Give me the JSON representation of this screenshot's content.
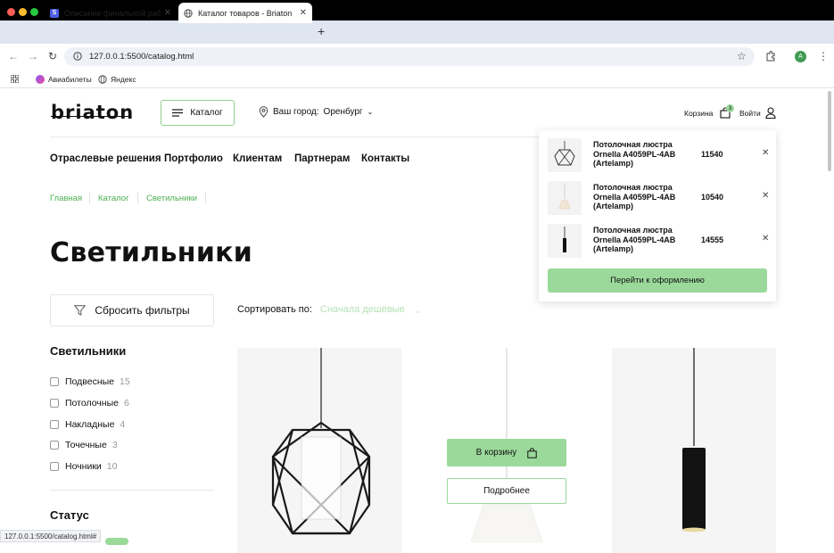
{
  "browser": {
    "tabs": [
      {
        "title": "Описание финальной работ",
        "favicon": "S"
      },
      {
        "title": "Каталог товаров - Briaton"
      }
    ],
    "url": "127.0.0.1:5500/catalog.html",
    "avatar_letter": "A",
    "bookmarks": [
      "Авиабилеты",
      "Яндекс"
    ],
    "status_url": "127.0.0.1:5500/catalog.html#"
  },
  "header": {
    "logo": "briaton",
    "catalog_label": "Каталог",
    "city_label": "Ваш город:",
    "city_value": "Оренбург",
    "cart_label": "Корзина",
    "cart_count": "3",
    "login_label": "Войти"
  },
  "nav": [
    "Отраслевые решения",
    "Портфолио",
    "Клиентам",
    "Партнерам",
    "Контакты"
  ],
  "breadcrumbs": [
    "Главная",
    "Каталог",
    "Светильники"
  ],
  "page_title": "Светильники",
  "filters": {
    "reset_label": "Сбросить фильтры",
    "sort_label": "Сортировать по:",
    "sort_value": "Сначала дешёвые",
    "category_title": "Светильники",
    "categories": [
      {
        "label": "Подвесные",
        "count": "15"
      },
      {
        "label": "Потолочные",
        "count": "6"
      },
      {
        "label": "Накладные",
        "count": "4"
      },
      {
        "label": "Точечные",
        "count": "3"
      },
      {
        "label": "Ночники",
        "count": "10"
      }
    ],
    "status_title": "Статус"
  },
  "product_buttons": {
    "add_to_cart": "В корзину",
    "details": "Подробнее"
  },
  "cart_popup": {
    "items": [
      {
        "name": "Потолочная люстра Ornella A4059PL-4AB (Artelamp)",
        "price": "11540"
      },
      {
        "name": "Потолочная люстра Ornella A4059PL-4AB (Artelamp)",
        "price": "10540"
      },
      {
        "name": "Потолочная люстра Ornella A4059PL-4AB (Artelamp)",
        "price": "14555"
      }
    ],
    "checkout_label": "Перейти к оформлению"
  },
  "colors": {
    "accent": "#9bd99b",
    "accent_text": "#4caf50"
  }
}
